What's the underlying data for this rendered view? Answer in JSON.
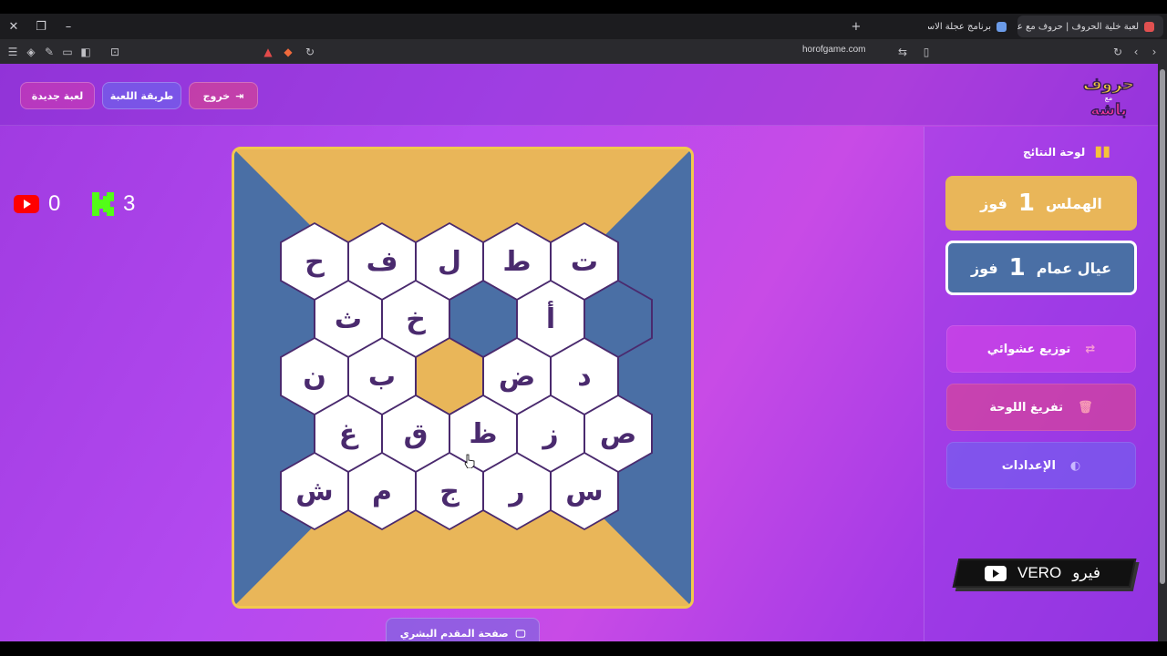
{
  "browser": {
    "tabs": [
      {
        "title": "لعبة خلية الحروف | حروف مع عزيز",
        "active": true
      },
      {
        "title": "برنامج عجلة الاسماء",
        "active": false
      }
    ],
    "new_tab_icon": "plus-icon",
    "url": "horofgame.com"
  },
  "header": {
    "buttons": {
      "new_game": "لعبة جديدة",
      "how_to_play": "طريقة اللعبة",
      "exit": "خروج"
    },
    "logo": {
      "line1": "حروف",
      "line2": "مع",
      "line3": "باشه"
    }
  },
  "counters": {
    "youtube": "0",
    "kick": "3"
  },
  "board": {
    "rows": [
      [
        {
          "letter": "ح",
          "state": "empty"
        },
        {
          "letter": "ف",
          "state": "empty"
        },
        {
          "letter": "ل",
          "state": "empty"
        },
        {
          "letter": "ط",
          "state": "empty"
        },
        {
          "letter": "ت",
          "state": "empty"
        }
      ],
      [
        {
          "letter": "ث",
          "state": "empty"
        },
        {
          "letter": "خ",
          "state": "empty"
        },
        {
          "letter": "",
          "state": "blue"
        },
        {
          "letter": "أ",
          "state": "empty"
        },
        {
          "letter": "",
          "state": "blue"
        }
      ],
      [
        {
          "letter": "ن",
          "state": "empty"
        },
        {
          "letter": "ب",
          "state": "empty"
        },
        {
          "letter": "",
          "state": "gold"
        },
        {
          "letter": "ض",
          "state": "empty"
        },
        {
          "letter": "د",
          "state": "empty"
        }
      ],
      [
        {
          "letter": "غ",
          "state": "empty"
        },
        {
          "letter": "ق",
          "state": "empty"
        },
        {
          "letter": "ظ",
          "state": "empty"
        },
        {
          "letter": "ز",
          "state": "empty"
        },
        {
          "letter": "ص",
          "state": "empty"
        }
      ],
      [
        {
          "letter": "ش",
          "state": "empty"
        },
        {
          "letter": "م",
          "state": "empty"
        },
        {
          "letter": "ج",
          "state": "empty"
        },
        {
          "letter": "ر",
          "state": "empty"
        },
        {
          "letter": "س",
          "state": "empty"
        }
      ]
    ],
    "colors": {
      "gold": "#e9b659",
      "blue": "#4a6fa5",
      "border": "#f2c94c"
    }
  },
  "presenter_button": "صفحة المقدم البشري",
  "sidebar": {
    "scoreboard_title": "لوحة النتائج",
    "teams": [
      {
        "name": "الهملس",
        "score": "1",
        "unit": "فوز",
        "color": "#e9b659"
      },
      {
        "name": "عيال عمام",
        "score": "1",
        "unit": "فوز",
        "color": "#4a6fa5"
      }
    ],
    "actions": {
      "shuffle": "توزيع عشوائي",
      "clear": "تفريغ اللوحة",
      "settings": "الإعدادات"
    }
  },
  "overlay": {
    "text": "VERO",
    "arabic": "فيرو"
  }
}
